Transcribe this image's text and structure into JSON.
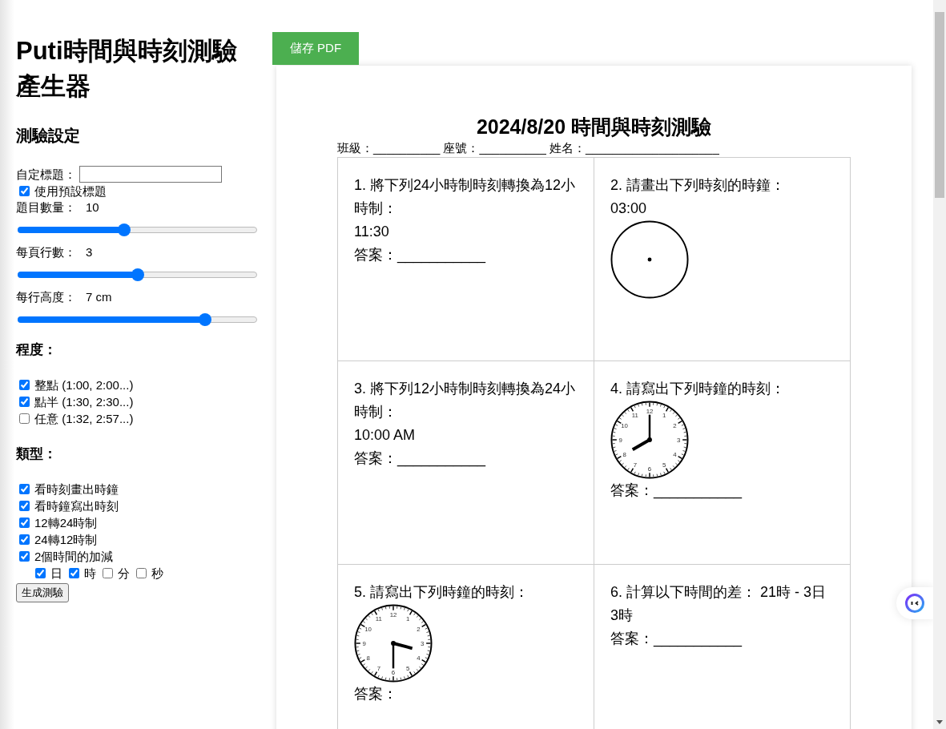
{
  "sidebar": {
    "title": "Puti時間與時刻測驗產生器",
    "section_title": "測驗設定",
    "custom_title": {
      "label": "自定標題："
    },
    "use_default_title": {
      "label": "使用預設標題",
      "checked": true
    },
    "sliders": [
      {
        "label": "題目數量：",
        "reading": "10",
        "level": 0.445
      },
      {
        "label": "每頁行數：",
        "reading": "3",
        "level": 0.5
      },
      {
        "label": "每行高度：",
        "reading": "7 cm",
        "level": 0.786
      }
    ],
    "level_heading": "程度：",
    "levels": [
      {
        "label": "整點 (1:00, 2:00...)",
        "checked": true
      },
      {
        "label": "點半 (1:30, 2:30...)",
        "checked": true
      },
      {
        "label": "任意 (1:32, 2:57...)",
        "checked": false
      }
    ],
    "type_heading": "類型：",
    "types": [
      {
        "label": "看時刻畫出時鐘",
        "checked": true
      },
      {
        "label": "看時鐘寫出時刻",
        "checked": true
      },
      {
        "label": "12轉24時制",
        "checked": true
      },
      {
        "label": "24轉12時制",
        "checked": true
      },
      {
        "label": "2個時間的加減",
        "checked": true
      }
    ],
    "units": [
      {
        "label": "日",
        "checked": true
      },
      {
        "label": "時",
        "checked": true
      },
      {
        "label": "分",
        "checked": false
      },
      {
        "label": "秒",
        "checked": false
      }
    ],
    "generate_button": "生成測驗"
  },
  "save_button": "儲存 PDF",
  "quiz": {
    "title": "2024/8/20 時間與時刻測驗",
    "fields": [
      {
        "label": "班級：",
        "blank": "__________"
      },
      {
        "label": "座號：",
        "blank": "__________"
      },
      {
        "label": "姓名：",
        "blank": "____________________"
      }
    ],
    "questions": [
      {
        "kind": "convert",
        "text": "1. 將下列24小時制時刻轉換為12小時制：",
        "time": "11:30",
        "answer": "答案：___________"
      },
      {
        "kind": "draw",
        "text": "2. 請畫出下列時刻的時鐘：",
        "time": "03:00"
      },
      {
        "kind": "convert",
        "text": "3. 將下列12小時制時刻轉換為24小時制：",
        "time": "10:00 AM",
        "answer": "答案：___________"
      },
      {
        "kind": "read",
        "text": "4. 請寫出下列時鐘的時刻：",
        "dial_numbers": [
          "1",
          "2",
          "3",
          "4",
          "5",
          "6",
          "7",
          "8",
          "9",
          "10",
          "11",
          "12"
        ],
        "answer": "答案：___________"
      },
      {
        "kind": "read",
        "text": "5. 請寫出下列時鐘的時刻：",
        "dial_numbers": [
          "1",
          "2",
          "3",
          "4",
          "5",
          "6",
          "7",
          "8",
          "9",
          "10",
          "11",
          "12"
        ],
        "answer": "答案："
      },
      {
        "kind": "calc",
        "text": "6. 計算以下時間的差： 21時 - 3日3時",
        "answer": "答案：___________"
      }
    ]
  }
}
